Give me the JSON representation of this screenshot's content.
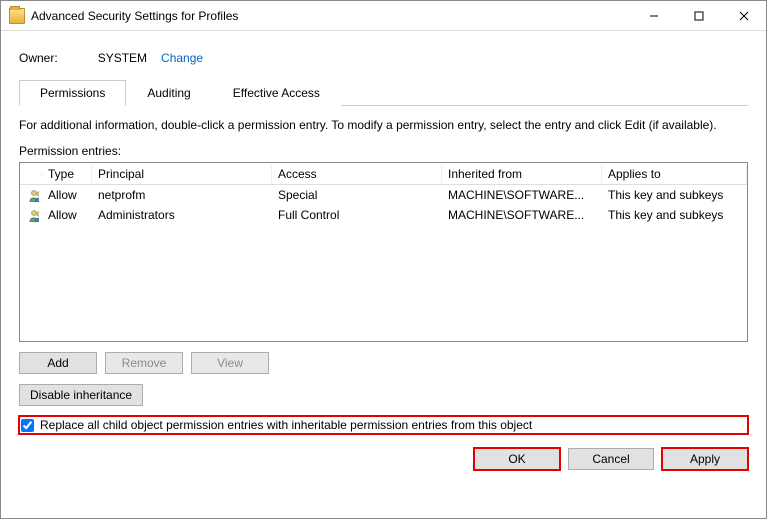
{
  "window": {
    "title": "Advanced Security Settings for Profiles"
  },
  "owner": {
    "label": "Owner:",
    "value": "SYSTEM",
    "change": "Change"
  },
  "tabs": {
    "permissions": "Permissions",
    "auditing": "Auditing",
    "effective": "Effective Access",
    "active": "permissions"
  },
  "info": "For additional information, double-click a permission entry. To modify a permission entry, select the entry and click Edit (if available).",
  "entriesLabel": "Permission entries:",
  "columns": {
    "type": "Type",
    "principal": "Principal",
    "access": "Access",
    "inherited": "Inherited from",
    "applies": "Applies to"
  },
  "rows": [
    {
      "type": "Allow",
      "principal": "netprofm",
      "access": "Special",
      "inherited": "MACHINE\\SOFTWARE...",
      "applies": "This key and subkeys"
    },
    {
      "type": "Allow",
      "principal": "Administrators",
      "access": "Full Control",
      "inherited": "MACHINE\\SOFTWARE...",
      "applies": "This key and subkeys"
    }
  ],
  "buttons": {
    "add": "Add",
    "remove": "Remove",
    "view": "View",
    "disableInh": "Disable inheritance",
    "ok": "OK",
    "cancel": "Cancel",
    "apply": "Apply"
  },
  "checkbox": {
    "label": "Replace all child object permission entries with inheritable permission entries from this object",
    "checked": true
  }
}
